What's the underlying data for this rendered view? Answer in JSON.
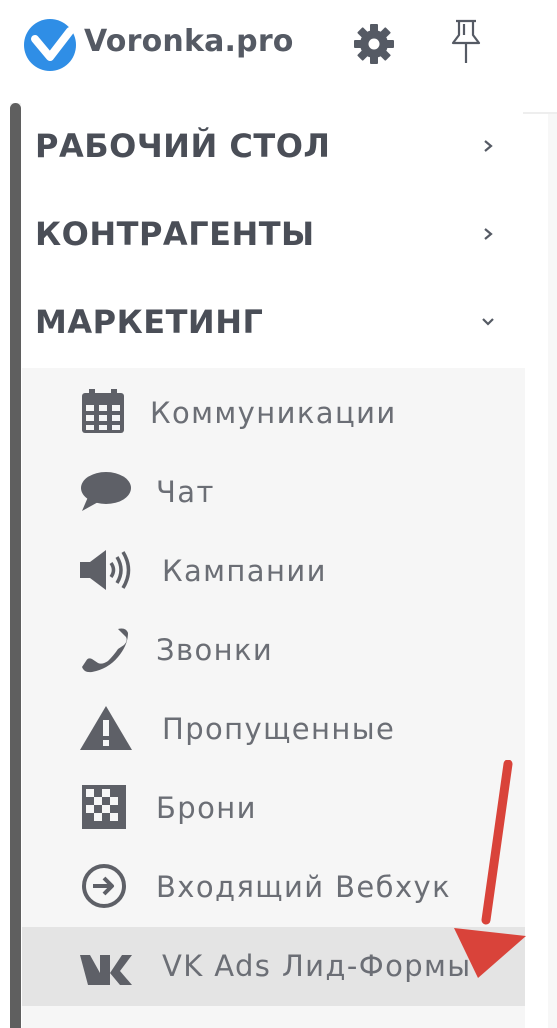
{
  "header": {
    "brand": "Voronka.pro",
    "logo_icon": "voronka-logo-icon",
    "settings_icon": "gear-icon",
    "pin_icon": "pin-icon"
  },
  "sidebar": {
    "sections": [
      {
        "label": "РАБОЧИЙ СТОЛ",
        "state": "collapsed",
        "icon": "chevron-right-icon"
      },
      {
        "label": "КОНТРАГЕНТЫ",
        "state": "collapsed",
        "icon": "chevron-right-icon"
      },
      {
        "label": "МАРКЕТИНГ",
        "state": "expanded",
        "icon": "chevron-down-icon"
      }
    ],
    "marketing_items": [
      {
        "label": "Коммуникации",
        "icon": "calendar-icon"
      },
      {
        "label": "Чат",
        "icon": "chat-bubble-icon"
      },
      {
        "label": "Кампании",
        "icon": "megaphone-icon"
      },
      {
        "label": "Звонки",
        "icon": "phone-icon"
      },
      {
        "label": "Пропущенные",
        "icon": "warning-icon"
      },
      {
        "label": "Брони",
        "icon": "checkerboard-icon"
      },
      {
        "label": "Входящий Вебхук",
        "icon": "arrow-circle-right-icon"
      },
      {
        "label": "VK Ads Лид-Формы",
        "icon": "vk-icon",
        "selected": true
      }
    ]
  },
  "annotation": {
    "icon": "red-arrow-icon",
    "color": "#d9433a"
  },
  "colors": {
    "logo_blue": "#2f8ee6",
    "text": "#4a4e57",
    "submenu_text": "#6b6e75",
    "active_row": "#e4e4e4"
  }
}
